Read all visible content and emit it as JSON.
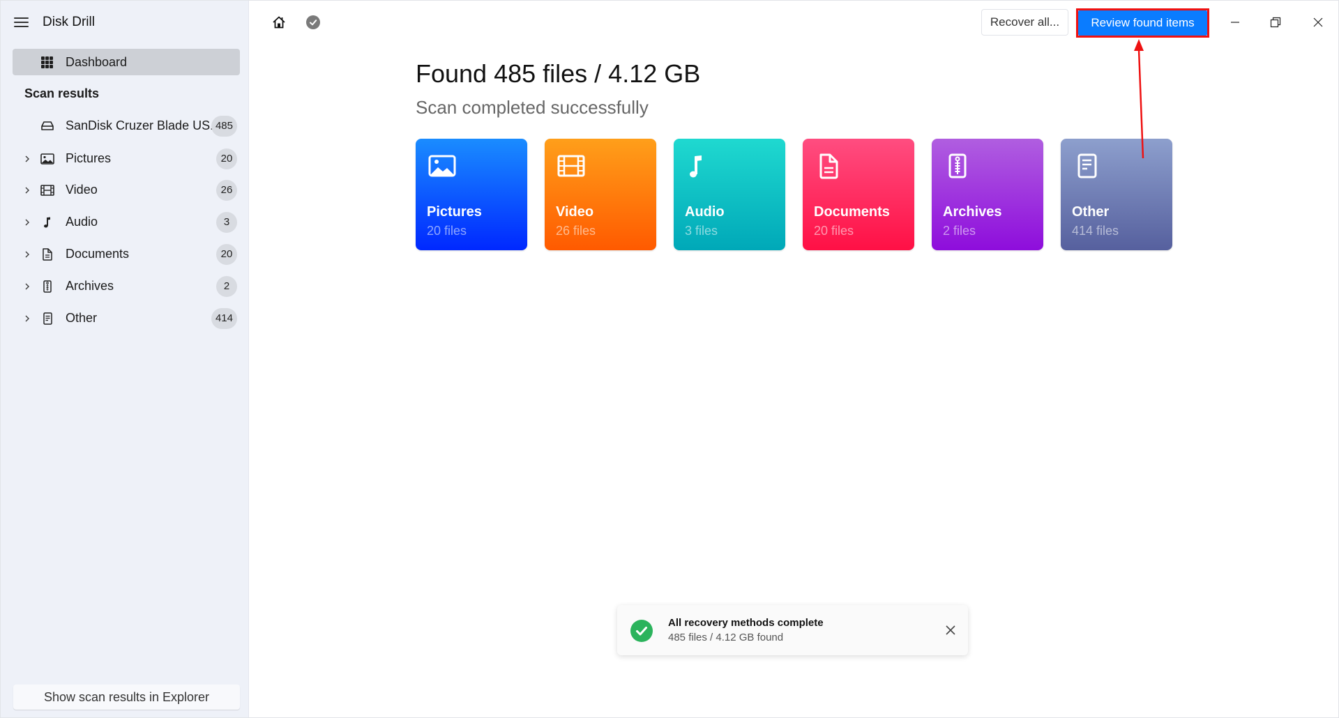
{
  "app": {
    "title": "Disk Drill"
  },
  "sidebar": {
    "dashboard_label": "Dashboard",
    "section_label": "Scan results",
    "device": {
      "label": "SanDisk Cruzer Blade US...",
      "count": "485",
      "icon": "drive-icon"
    },
    "items": [
      {
        "label": "Pictures",
        "count": "20",
        "icon": "image-icon"
      },
      {
        "label": "Video",
        "count": "26",
        "icon": "film-icon"
      },
      {
        "label": "Audio",
        "count": "3",
        "icon": "music-note-icon"
      },
      {
        "label": "Documents",
        "count": "20",
        "icon": "document-icon"
      },
      {
        "label": "Archives",
        "count": "2",
        "icon": "archive-zip-icon"
      },
      {
        "label": "Other",
        "count": "414",
        "icon": "other-file-icon"
      }
    ],
    "explorer_button": "Show scan results in Explorer"
  },
  "toolbar": {
    "recover_all": "Recover all...",
    "review_found": "Review found items"
  },
  "main": {
    "heading": "Found 485 files / 4.12 GB",
    "subheading": "Scan completed successfully",
    "cards": [
      {
        "title": "Pictures",
        "subtitle": "20 files",
        "color_top": "#1a8cff",
        "color_bottom": "#0028ff"
      },
      {
        "title": "Video",
        "subtitle": "26 files",
        "color_top": "#ff9f1a",
        "color_bottom": "#ff5a00"
      },
      {
        "title": "Audio",
        "subtitle": "3 files",
        "color_top": "#1fd9d0",
        "color_bottom": "#00a8b8"
      },
      {
        "title": "Documents",
        "subtitle": "20 files",
        "color_top": "#ff4d80",
        "color_bottom": "#ff1045"
      },
      {
        "title": "Archives",
        "subtitle": "2 files",
        "color_top": "#b05ee0",
        "color_bottom": "#8e0ddc"
      },
      {
        "title": "Other",
        "subtitle": "414 files",
        "color_top": "#8d9fcd",
        "color_bottom": "#56609e"
      }
    ]
  },
  "toast": {
    "title": "All recovery methods complete",
    "message": "485 files / 4.12 GB found"
  },
  "colors": {
    "accent": "#0a7cff",
    "annotation": "#ee1111",
    "success": "#2bb35c",
    "sidebar_bg": "#eef1f8"
  }
}
